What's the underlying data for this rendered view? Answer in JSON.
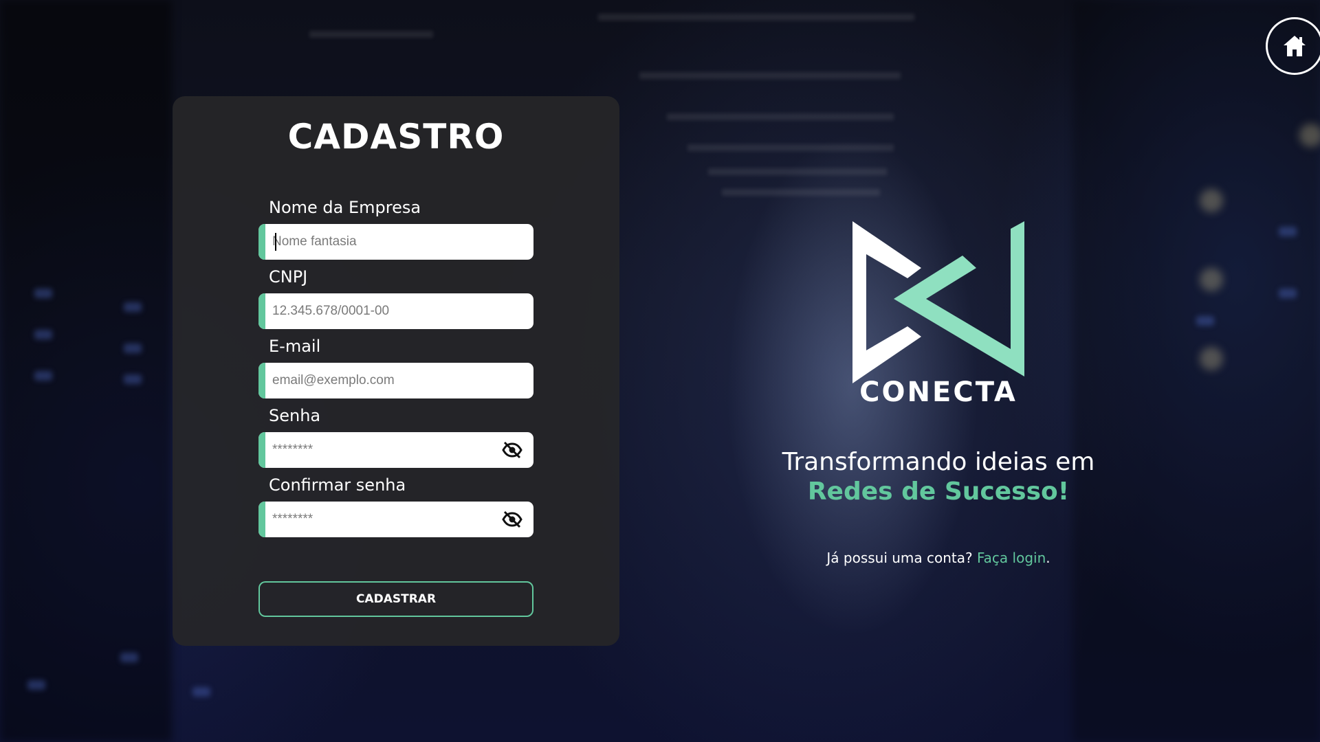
{
  "form": {
    "title": "CADASTRO",
    "fields": [
      {
        "label": "Nome da Empresa",
        "placeholder": "Nome fantasia"
      },
      {
        "label": "CNPJ",
        "placeholder": "12.345.678/0001-00"
      },
      {
        "label": "E-mail",
        "placeholder": "email@exemplo.com"
      },
      {
        "label": "Senha",
        "placeholder": "********"
      },
      {
        "label": "Confirmar senha",
        "placeholder": "********"
      }
    ],
    "submit_label": "CADASTRAR"
  },
  "brand": {
    "name": "CONECTA",
    "tagline_line1": "Transformando ideias em",
    "tagline_line2": "Redes de Sucesso!",
    "login_prompt": "Já possui uma conta?",
    "login_link": "Faça login",
    "login_suffix": "."
  },
  "icons": {
    "home": "home-icon",
    "password_toggle": "eye-off-icon"
  },
  "colors": {
    "accent": "#62c79d",
    "card": "#262628"
  }
}
